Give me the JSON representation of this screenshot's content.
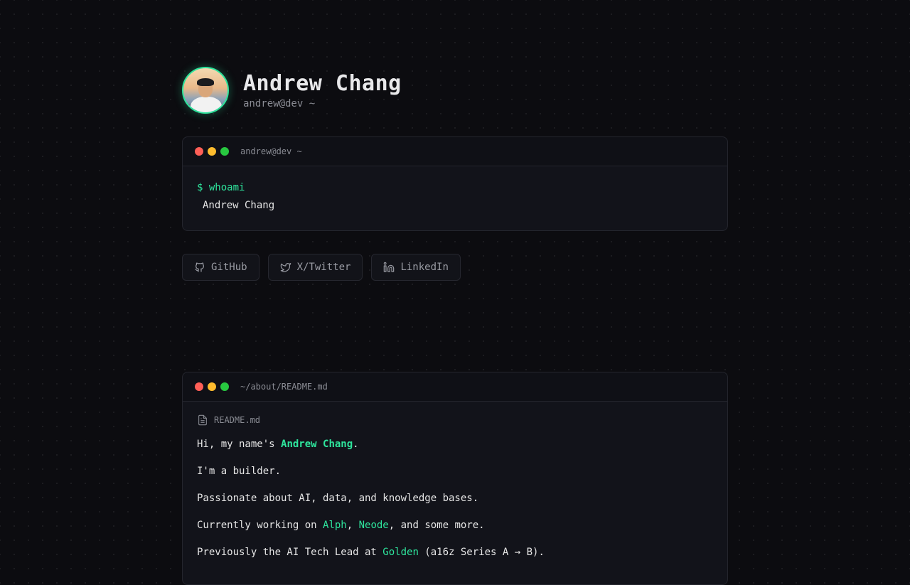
{
  "profile": {
    "name": "Andrew Chang",
    "handle": "andrew@dev ~"
  },
  "terminal": {
    "title": "andrew@dev ~",
    "command": "$ whoami",
    "output": "Andrew Chang"
  },
  "socials": [
    {
      "label": "GitHub",
      "icon": "github-icon"
    },
    {
      "label": "X/Twitter",
      "icon": "twitter-icon"
    },
    {
      "label": "LinkedIn",
      "icon": "linkedin-icon"
    }
  ],
  "readme": {
    "title": "~/about/README.md",
    "file_label": "README.md",
    "line1_prefix": "Hi, my name's ",
    "line1_name": "Andrew Chang",
    "line1_suffix": ".",
    "line2": "I'm a builder.",
    "line3": "Passionate about AI, data, and knowledge bases.",
    "line4_prefix": "Currently working on ",
    "line4_link1": "Alph",
    "line4_sep": ", ",
    "line4_link2": "Neode",
    "line4_suffix": ", and some more.",
    "line5_prefix": "Previously the AI Tech Lead at ",
    "line5_link": "Golden",
    "line5_suffix": " (a16z Series A → B)."
  },
  "colors": {
    "accent": "#2ee59d",
    "background": "#0c0c10",
    "window": "#12131a",
    "dot_red": "#ff5f57",
    "dot_yellow": "#febc2e",
    "dot_green": "#28c840"
  }
}
